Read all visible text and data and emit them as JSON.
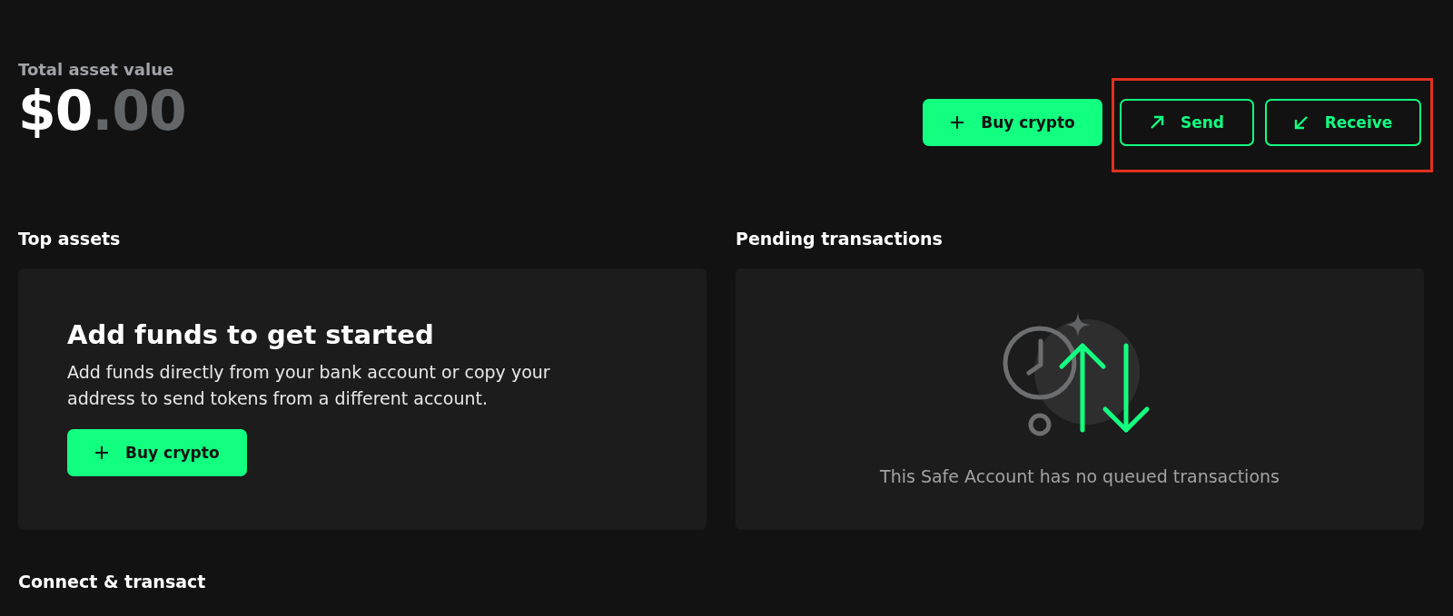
{
  "overview": {
    "label": "Total asset value",
    "amount": {
      "whole": "$0",
      "fraction": ".00"
    },
    "actions": [
      {
        "kind": "buy",
        "label": "Buy crypto"
      },
      {
        "kind": "send",
        "label": "Send"
      },
      {
        "kind": "receive",
        "label": "Receive"
      }
    ],
    "highlight_frame": true
  },
  "top_assets": {
    "title": "Top assets",
    "card": {
      "heading": "Add funds to get started",
      "text": "Add funds directly from your bank account or copy your address to send tokens from a different account.",
      "button": {
        "kind": "buy",
        "label": "Buy crypto"
      }
    }
  },
  "pending": {
    "title": "Pending transactions",
    "empty_text": "This Safe Account has no queued transactions"
  },
  "next_section": {
    "title": "Connect & transact"
  }
}
